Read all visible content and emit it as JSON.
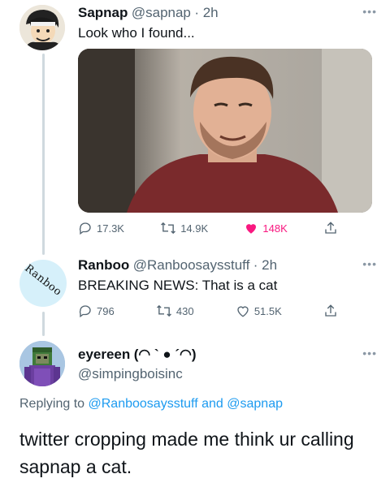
{
  "tweet1": {
    "name": "Sapnap",
    "handle": "@sapnap",
    "time": "· 2h",
    "text": "Look who I found...",
    "replies": "17.3K",
    "retweets": "14.9K",
    "likes": "148K",
    "media_icon": "photo-of-person"
  },
  "tweet2": {
    "name": "Ranboo",
    "handle": "@Ranboosaysstuff",
    "time": "· 2h",
    "text": "BREAKING NEWS: That is a cat",
    "avatar_text": "Ranboo",
    "replies": "796",
    "retweets": "430",
    "likes": "51.5K"
  },
  "tweet3": {
    "name": "eyereen",
    "name_emoticon": "(◠ ` ● ´◠)",
    "handle": "@simpingboisinc",
    "replying_prefix": "Replying to",
    "replying_user1": "@Ranboosaysstuff",
    "replying_and": "and",
    "replying_user2": "@sapnap",
    "text": "twitter cropping made me think ur calling sapnap a cat."
  },
  "colors": {
    "link": "#1d9bf0",
    "like": "#f91880",
    "muted": "#536471",
    "thread_line": "#cfd9de"
  }
}
